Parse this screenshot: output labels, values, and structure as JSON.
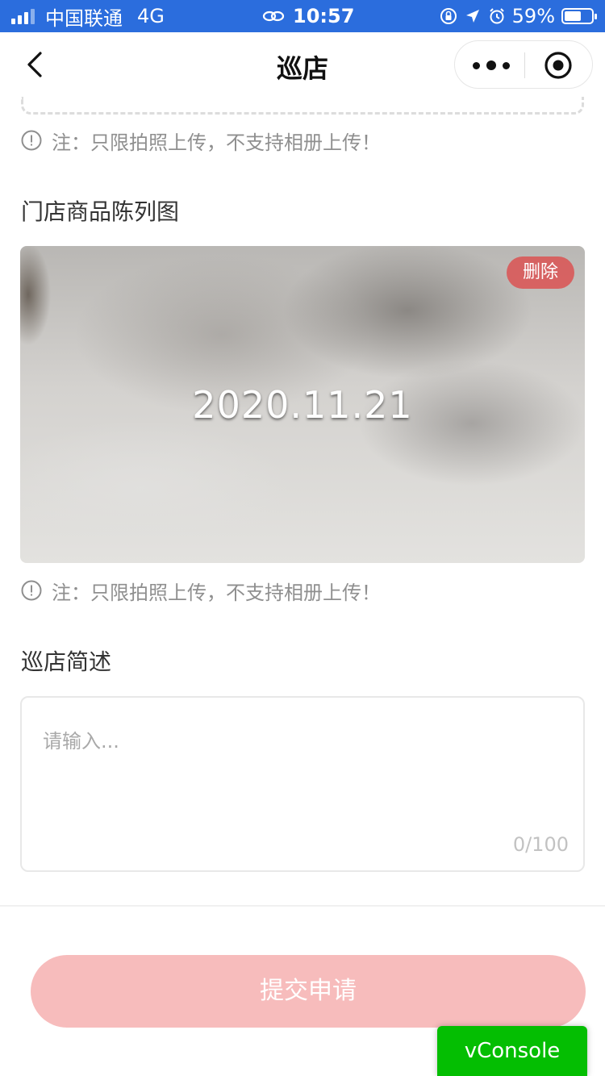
{
  "status_bar": {
    "carrier": "中国联通",
    "network": "4G",
    "time": "10:57",
    "battery": "59%"
  },
  "nav": {
    "title": "巡店",
    "back_icon": "chevron-left-icon",
    "more_icon": "more-dots-icon",
    "close_icon": "target-icon"
  },
  "notes": {
    "first": "注：只限拍照上传，不支持相册上传！",
    "second": "注：只限拍照上传，不支持相册上传！"
  },
  "display_section": {
    "label": "门店商品陈列图",
    "photo_date": "2020.11.21",
    "delete_label": "删除"
  },
  "description_section": {
    "label": "巡店简述",
    "placeholder": "请输入...",
    "counter": "0/100"
  },
  "submit_label": "提交申请",
  "vconsole_label": "vConsole",
  "colors": {
    "status_bar_bg": "#2b6ddd",
    "submit_bg": "#f7bcbc",
    "delete_badge_bg": "#da5252",
    "vconsole_bg": "#04be02"
  }
}
